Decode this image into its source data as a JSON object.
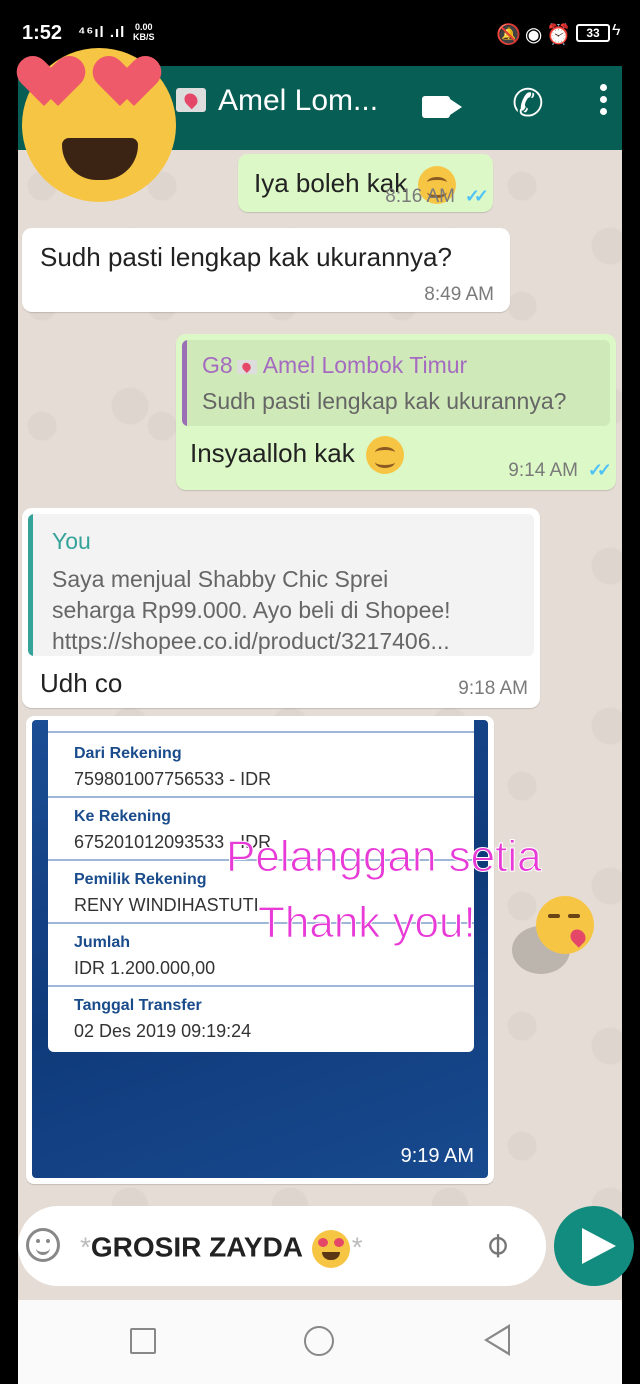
{
  "status_bar": {
    "time": "1:52",
    "signal": "⁴⁶ıl .ıl",
    "speed_value": "0.00",
    "speed_unit": "KB/S",
    "icons": "🔕◉⏰",
    "battery": "33"
  },
  "header": {
    "contact_name": "Amel Lom...",
    "icons": [
      "video-call-icon",
      "voice-call-icon",
      "more-options-icon"
    ],
    "color": "#075e54"
  },
  "messages": [
    {
      "direction": "out",
      "text": "Iya boleh kak",
      "emoji": "smiling-face",
      "time": "8:16 AM",
      "read": true
    },
    {
      "direction": "in",
      "text": "Sudh pasti lengkap kak ukurannya?",
      "time": "8:49 AM"
    },
    {
      "direction": "out",
      "quote_author_prefix": "G8",
      "quote_author": "Amel Lombok Timur",
      "quote_text": "Sudh pasti lengkap kak ukurannya?",
      "text": "Insyaalloh kak",
      "emoji": "smiling-face",
      "time": "9:14 AM",
      "read": true
    },
    {
      "direction": "in",
      "quote_author": "You",
      "quote_lines": [
        "Saya menjual Shabby Chic Sprei",
        "seharga Rp99.000. Ayo beli di Shopee!",
        "https://shopee.co.id/product/3217406..."
      ],
      "text": "Udh co",
      "time": "9:18 AM"
    },
    {
      "direction": "in",
      "type": "image",
      "time": "9:19 AM",
      "receipt": [
        {
          "label": "Dari Rekening",
          "value": "759801007756533 - IDR"
        },
        {
          "label": "Ke Rekening",
          "value": "675201012093533 - IDR"
        },
        {
          "label": "Pemilik Rekening",
          "value": "RENY WINDIHASTUTI"
        },
        {
          "label": "Jumlah",
          "value": "IDR 1.200.000,00"
        },
        {
          "label": "Tanggal Transfer",
          "value": "02 Des 2019 09:19:24"
        }
      ]
    }
  ],
  "overlay": {
    "line1": "Pelanggan setia",
    "line2": "Thank you!",
    "color": "#e83ad6"
  },
  "input": {
    "star_open": "*",
    "text": "GROSIR ZAYDA",
    "star_close": "*"
  },
  "colors": {
    "outgoing_bubble": "#dcf8c6",
    "incoming_bubble": "#ffffff",
    "chat_background": "#e5ddd5",
    "send_button": "#128c7e",
    "read_ticks": "#4fc3f7"
  }
}
